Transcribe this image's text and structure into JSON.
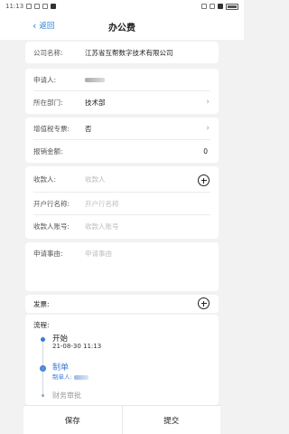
{
  "status": {
    "time": "11:13",
    "battery": ""
  },
  "nav": {
    "back_label": "返回",
    "title": "办公费"
  },
  "company": {
    "label": "公司名称:",
    "value": "江苏省互帮数字技术有限公司"
  },
  "applicant": {
    "label": "申请人:",
    "value": ""
  },
  "department": {
    "label": "所在部门:",
    "value": "技术部"
  },
  "vat_invoice": {
    "label": "增值税专票:",
    "value": "否"
  },
  "total": {
    "label": "报销金额:",
    "value": "0"
  },
  "payee": {
    "name_label": "收款人:",
    "name_placeholder": "收款人",
    "bank_label": "开户行名称:",
    "bank_placeholder": "开户行名称",
    "account_label": "收款人账号:",
    "account_placeholder": "收款人账号"
  },
  "reason": {
    "label": "申请事由:",
    "placeholder": "申请事由"
  },
  "invoice": {
    "label": "发票:"
  },
  "workflow": {
    "label": "流程:",
    "steps": [
      {
        "title": "开始",
        "time": "21-08-30 11:13"
      },
      {
        "title": "制单",
        "sub": "制单人:"
      },
      {
        "title": "财务审批"
      }
    ]
  },
  "actions": {
    "save": "保存",
    "submit": "提交"
  }
}
